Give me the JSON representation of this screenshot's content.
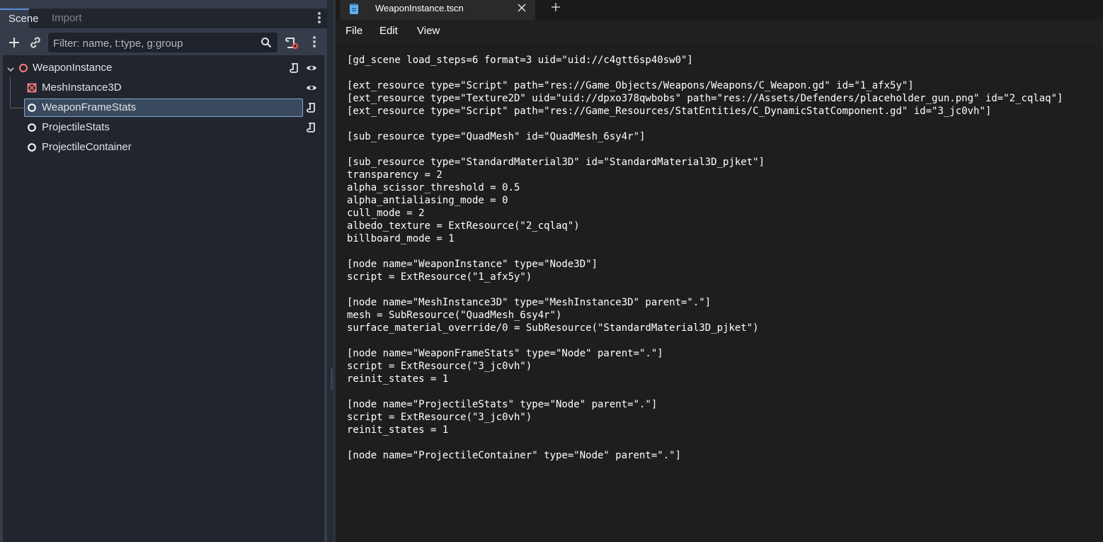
{
  "scene_dock": {
    "tabs": [
      "Scene",
      "Import"
    ],
    "filter_placeholder": "Filter: name, t:type, g:group",
    "icons": {
      "add": "plus-icon",
      "instance": "link-icon",
      "search": "search-icon",
      "script_filter": "script-filter-icon",
      "menu": "vertical-dots-icon"
    },
    "tree": [
      {
        "label": "WeaponInstance",
        "icon": "node3d-icon",
        "script": true,
        "visible": true,
        "selected": false
      },
      {
        "label": "MeshInstance3D",
        "icon": "mesh-instance-icon",
        "script": false,
        "visible": true,
        "selected": false
      },
      {
        "label": "WeaponFrameStats",
        "icon": "node-icon",
        "script": true,
        "visible": false,
        "selected": true
      },
      {
        "label": "ProjectileStats",
        "icon": "node-icon",
        "script": true,
        "visible": false,
        "selected": false
      },
      {
        "label": "ProjectileContainer",
        "icon": "node-icon",
        "script": false,
        "visible": false,
        "selected": false
      }
    ]
  },
  "notepad": {
    "tab_title": "WeaponInstance.tscn",
    "menu": [
      "File",
      "Edit",
      "View"
    ],
    "lines": [
      "[gd_scene load_steps=6 format=3 uid=\"uid://c4gtt6sp40sw0\"]",
      "",
      "[ext_resource type=\"Script\" path=\"res://Game_Objects/Weapons/Weapons/C_Weapon.gd\" id=\"1_afx5y\"]",
      "[ext_resource type=\"Texture2D\" uid=\"uid://dpxo378qwbobs\" path=\"res://Assets/Defenders/placeholder_gun.png\" id=\"2_cqlaq\"]",
      "[ext_resource type=\"Script\" path=\"res://Game_Resources/StatEntities/C_DynamicStatComponent.gd\" id=\"3_jc0vh\"]",
      "",
      "[sub_resource type=\"QuadMesh\" id=\"QuadMesh_6sy4r\"]",
      "",
      "[sub_resource type=\"StandardMaterial3D\" id=\"StandardMaterial3D_pjket\"]",
      "transparency = 2",
      "alpha_scissor_threshold = 0.5",
      "alpha_antialiasing_mode = 0",
      "cull_mode = 2",
      "albedo_texture = ExtResource(\"2_cqlaq\")",
      "billboard_mode = 1",
      "",
      "[node name=\"WeaponInstance\" type=\"Node3D\"]",
      "script = ExtResource(\"1_afx5y\")",
      "",
      "[node name=\"MeshInstance3D\" type=\"MeshInstance3D\" parent=\".\"]",
      "mesh = SubResource(\"QuadMesh_6sy4r\")",
      "surface_material_override/0 = SubResource(\"StandardMaterial3D_pjket\")",
      "",
      "[node name=\"WeaponFrameStats\" type=\"Node\" parent=\".\"]",
      "script = ExtResource(\"3_jc0vh\")",
      "reinit_states = 1",
      "",
      "[node name=\"ProjectileStats\" type=\"Node\" parent=\".\"]",
      "script = ExtResource(\"3_jc0vh\")",
      "reinit_states = 1",
      "",
      "[node name=\"ProjectileContainer\" type=\"Node\" parent=\".\"]"
    ]
  },
  "colors": {
    "dock_bg": "#363d4a",
    "tree_bg": "#21262e",
    "selection": "#3a4a5e",
    "editor_bg": "#1e1e1e",
    "node3d_icon": "#fc7f7f",
    "mesh_icon": "#fc7f7f"
  }
}
